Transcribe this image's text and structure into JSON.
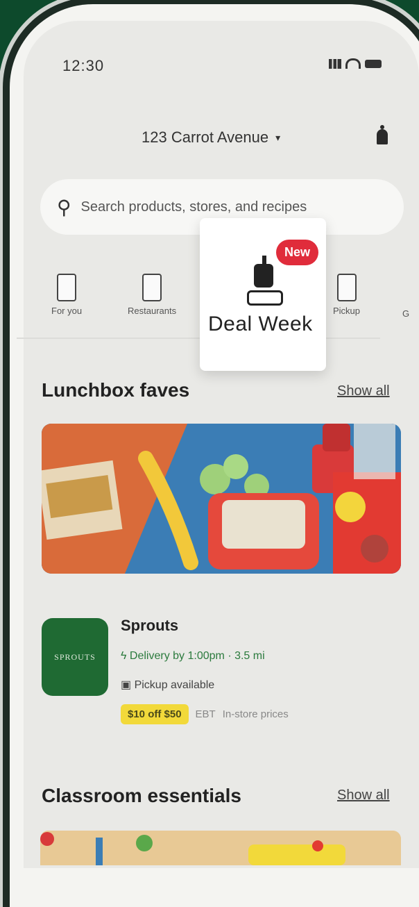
{
  "status_bar": {
    "time": "12:30"
  },
  "header": {
    "address": "123 Carrot Avenue",
    "caret": "▾"
  },
  "search": {
    "placeholder": "Search products, stores, and recipes",
    "icon": "search-icon"
  },
  "categories": [
    {
      "label": "For you",
      "icon": "bag-icon"
    },
    {
      "label": "Restaurants",
      "icon": "takeout-icon"
    },
    {
      "label": "Pickup",
      "icon": "car-icon"
    },
    {
      "label": "G",
      "icon": "grocery-icon"
    }
  ],
  "highlight": {
    "label": "Deal Week",
    "badge": "New",
    "icon": "deal-week-icon"
  },
  "sections": [
    {
      "title": "Lunchbox faves",
      "show_all": "Show all"
    },
    {
      "title": "Classroom essentials",
      "show_all": "Show all"
    }
  ],
  "store": {
    "name": "Sprouts",
    "logo_text": "SPROUTS",
    "delivery": "Delivery by 1:00pm · 3.5 mi",
    "pickup": "Pickup available",
    "promo": "$10 off $50",
    "ebt": "EBT",
    "pricing": "In-store prices"
  },
  "colors": {
    "background": "#0d4a2c",
    "badge": "#e02c3b",
    "promo": "#f2d93a",
    "store_logo": "#1f6a33"
  }
}
